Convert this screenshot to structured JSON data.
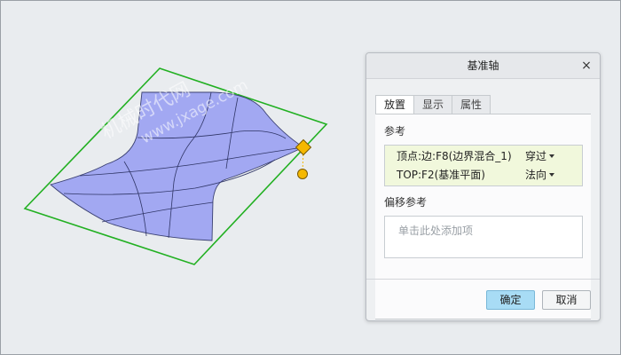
{
  "watermark": {
    "line1": "机械时代网",
    "line2": "www.jxage.com"
  },
  "dialog": {
    "title": "基准轴",
    "close_glyph": "×",
    "tabs": [
      {
        "label": "放置",
        "active": true
      },
      {
        "label": "显示",
        "active": false
      },
      {
        "label": "属性",
        "active": false
      }
    ],
    "references_label": "参考",
    "references": [
      {
        "ref": "顶点:边:F8(边界混合_1)",
        "constraint": "穿过"
      },
      {
        "ref": "TOP:F2(基准平面)",
        "constraint": "法向"
      }
    ],
    "offset_label": "偏移参考",
    "offset_placeholder": "单击此处添加项",
    "ok_label": "确定",
    "cancel_label": "取消"
  },
  "colors": {
    "surface_fill": "#a2a8f2",
    "surface_edge": "#2f3566",
    "datum_plane": "#22b022",
    "handle": "#f5b800",
    "ref_highlight": "#f1f8dc",
    "ok_button": "#a8dcf5"
  }
}
